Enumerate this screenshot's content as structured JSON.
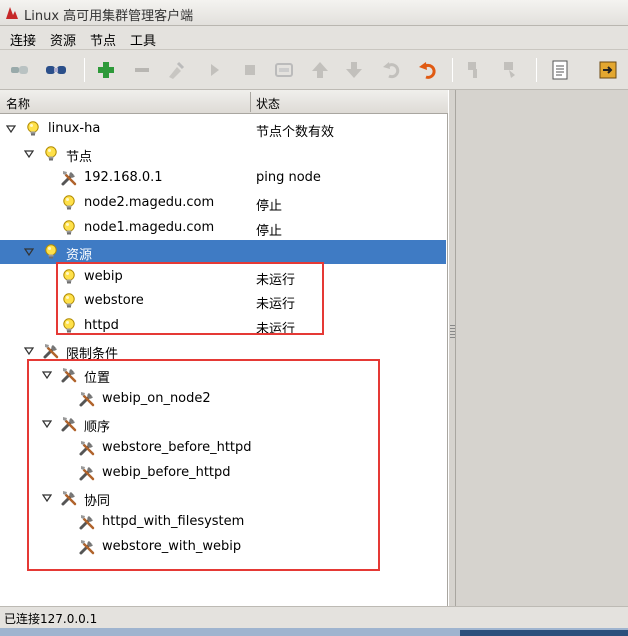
{
  "window": {
    "title": "Linux 高可用集群管理客户端"
  },
  "menu": [
    "连接",
    "资源",
    "节点",
    "工具"
  ],
  "toolbar": {
    "icons": [
      "connect-icon",
      "disconnect-icon",
      "add-icon",
      "remove-icon",
      "cleanup-icon",
      "start-icon",
      "stop-icon",
      "migrate-icon",
      "move-up-icon",
      "move-down-icon",
      "undo-icon",
      "refresh-icon",
      "standby-icon",
      "active-icon",
      "log-icon",
      "exit-icon"
    ]
  },
  "tree": {
    "columns": {
      "name": "名称",
      "status": "状态"
    },
    "root": {
      "label": "linux-ha",
      "status": "节点个数有效"
    },
    "nodes_group": {
      "label": "节点"
    },
    "nodes": [
      {
        "label": "192.168.0.1",
        "status": "ping node",
        "icon": "ping-node-icon"
      },
      {
        "label": "node2.magedu.com",
        "status": "停止",
        "icon": "bulb-icon"
      },
      {
        "label": "node1.magedu.com",
        "status": "停止",
        "icon": "bulb-icon"
      }
    ],
    "resources_group": {
      "label": "资源"
    },
    "resources": [
      {
        "label": "webip",
        "status": "未运行"
      },
      {
        "label": "webstore",
        "status": "未运行"
      },
      {
        "label": "httpd",
        "status": "未运行"
      }
    ],
    "constraints_group": {
      "label": "限制条件"
    },
    "location": {
      "label": "位置",
      "items": [
        "webip_on_node2"
      ]
    },
    "order": {
      "label": "顺序",
      "items": [
        "webstore_before_httpd",
        "webip_before_httpd"
      ]
    },
    "colocation": {
      "label": "协同",
      "items": [
        "httpd_with_filesystem",
        "webstore_with_webip"
      ]
    }
  },
  "statusbar": {
    "text": "已连接127.0.0.1"
  },
  "colors": {
    "selection": "#3f7bc4",
    "highlight": "#e53935"
  }
}
